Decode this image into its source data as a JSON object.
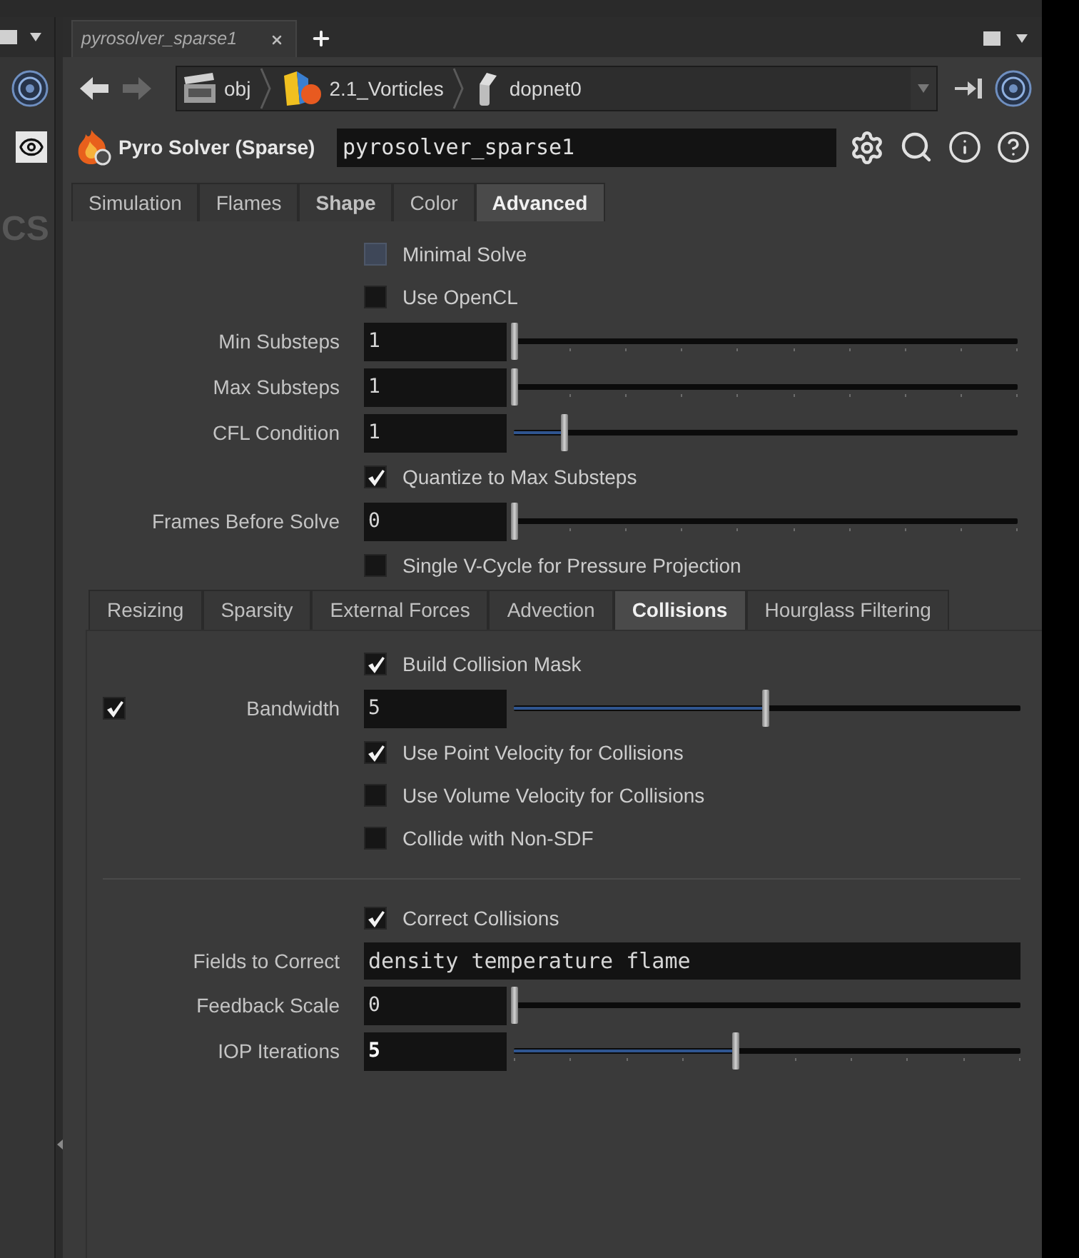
{
  "left_pane": {
    "text": "CS"
  },
  "tab_bar": {
    "tabs": [
      {
        "label": "pyrosolver_sparse1",
        "selected": true
      }
    ]
  },
  "path_bar": {
    "crumbs": [
      {
        "label": "obj",
        "kind": "obj"
      },
      {
        "label": "2.1_Vorticles",
        "kind": "geo"
      },
      {
        "label": "dopnet0",
        "kind": "dopnet"
      }
    ]
  },
  "node": {
    "type": "Pyro Solver (Sparse)",
    "name": "pyrosolver_sparse1"
  },
  "tabs": [
    {
      "label": "Simulation",
      "selected": false,
      "modified": false
    },
    {
      "label": "Flames",
      "selected": false,
      "modified": false
    },
    {
      "label": "Shape",
      "selected": false,
      "modified": true
    },
    {
      "label": "Color",
      "selected": false,
      "modified": false
    },
    {
      "label": "Advanced",
      "selected": true,
      "modified": false
    }
  ],
  "params": [
    {
      "kind": "checkbox",
      "label": "Minimal Solve",
      "checked": false,
      "focused": true
    },
    {
      "kind": "checkbox",
      "label": "Use OpenCL",
      "checked": false
    },
    {
      "kind": "slider",
      "label": "Min Substeps",
      "value": "1",
      "level": 0,
      "ticks": true,
      "modified": false
    },
    {
      "kind": "slider",
      "label": "Max Substeps",
      "value": "1",
      "level": 0,
      "ticks": true,
      "modified": false
    },
    {
      "kind": "slider",
      "label": "CFL Condition",
      "value": "1",
      "level": 0.1,
      "ticks": false,
      "modified": false
    },
    {
      "kind": "checkbox",
      "label": "Quantize to Max Substeps",
      "checked": true
    },
    {
      "kind": "slider",
      "label": "Frames Before Solve",
      "value": "0",
      "level": 0,
      "ticks": true,
      "modified": false
    },
    {
      "kind": "checkbox",
      "label": "Single V-Cycle for Pressure Projection",
      "checked": false
    }
  ],
  "subtabs": [
    {
      "label": "Resizing",
      "selected": false
    },
    {
      "label": "Sparsity",
      "selected": false
    },
    {
      "label": "External Forces",
      "selected": false
    },
    {
      "label": "Advection",
      "selected": false
    },
    {
      "label": "Collisions",
      "selected": true
    },
    {
      "label": "Hourglass Filtering",
      "selected": false
    }
  ],
  "collision_params": [
    {
      "kind": "checkbox",
      "label": "Build Collision Mask",
      "checked": true
    },
    {
      "kind": "slider",
      "label": "Bandwidth",
      "value": "5",
      "level": 0.5,
      "ticks": false,
      "modified": false,
      "toggle": {
        "checked": true
      }
    },
    {
      "kind": "checkbox",
      "label": "Use Point Velocity for Collisions",
      "checked": true
    },
    {
      "kind": "checkbox",
      "label": "Use Volume Velocity for Collisions",
      "checked": false
    },
    {
      "kind": "checkbox",
      "label": "Collide with Non-SDF",
      "checked": false
    },
    {
      "kind": "separator"
    },
    {
      "kind": "checkbox",
      "label": "Correct Collisions",
      "checked": true
    },
    {
      "kind": "text",
      "label": "Fields to Correct",
      "value": "density temperature flame"
    },
    {
      "kind": "slider",
      "label": "Feedback Scale",
      "value": "0",
      "level": 0,
      "ticks": false,
      "modified": false
    },
    {
      "kind": "slider",
      "label": "IOP Iterations",
      "value": "5",
      "level": 0.44,
      "ticks": true,
      "modified": true
    }
  ]
}
